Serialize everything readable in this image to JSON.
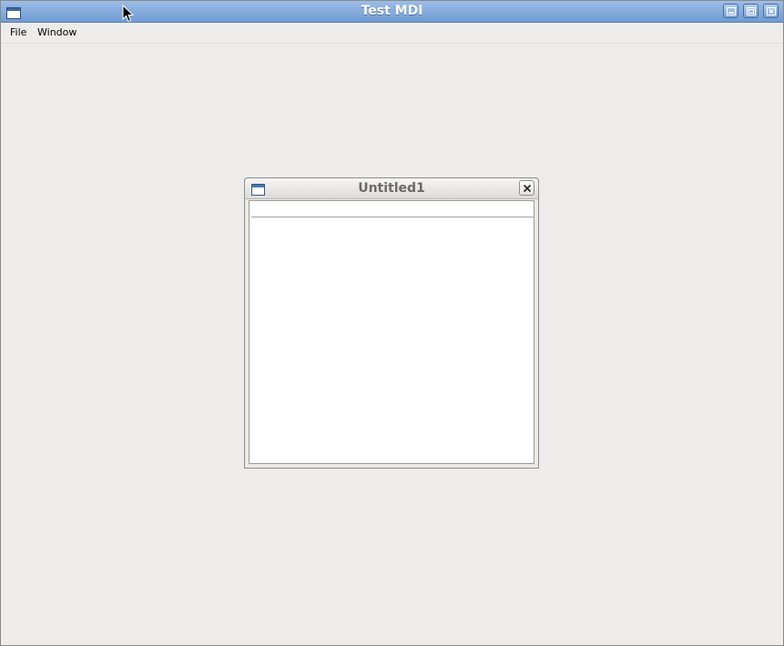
{
  "app": {
    "title": "Test MDI"
  },
  "menubar": {
    "items": [
      {
        "label": "File"
      },
      {
        "label": "Window"
      }
    ]
  },
  "child_window": {
    "title": "Untitled1"
  },
  "icons": {
    "window_menu": "window-icon",
    "minimize": "minimize-icon",
    "maximize": "maximize-icon",
    "close": "close-icon",
    "child_menu": "window-icon",
    "child_close": "close-icon",
    "pointer": "mouse-cursor-icon"
  },
  "colors": {
    "titlebar_top": "#9cbde6",
    "titlebar_bottom": "#6f9bd3",
    "background": "#edecea",
    "child_title_text": "#6a6a6a"
  }
}
